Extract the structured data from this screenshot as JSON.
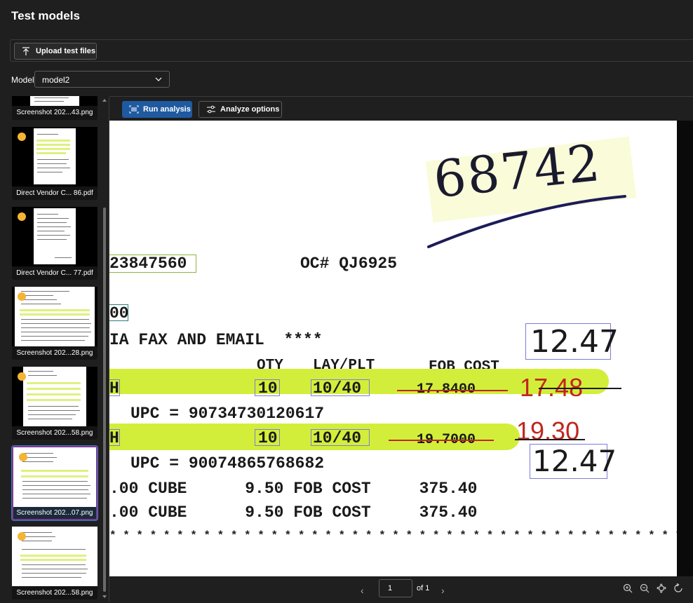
{
  "page": {
    "title": "Test models"
  },
  "toolbar": {
    "upload_label": "Upload test files"
  },
  "model": {
    "label": "Model",
    "selected": "model2"
  },
  "files": [
    {
      "name": "Screenshot 202...43.png",
      "status": "",
      "selected": false
    },
    {
      "name": "Direct Vendor C... 86.pdf",
      "status": "pending",
      "selected": false
    },
    {
      "name": "Direct Vendor C... 77.pdf",
      "status": "pending",
      "selected": false
    },
    {
      "name": "Screenshot 202...28.png",
      "status": "pending",
      "selected": false
    },
    {
      "name": "Screenshot 202...58.png",
      "status": "pending",
      "selected": false
    },
    {
      "name": "Screenshot 202...07.png",
      "status": "pending",
      "selected": true
    },
    {
      "name": "Screenshot 202...58.png",
      "status": "pending",
      "selected": false
    }
  ],
  "viewer": {
    "run_label": "Run analysis",
    "options_label": "Analyze options",
    "document": {
      "handwritten_number": "68742",
      "ref_number": "23847560",
      "oc_label": "OC# QJ6925",
      "teal_value": "00",
      "fax_line": "IA FAX AND EMAIL  ****",
      "header_qty": "QTY",
      "header_lay": "LAY/PLT",
      "header_fob": "FOB COST",
      "row1_h": "H",
      "row1_qty": "10",
      "row1_lay": "10/40",
      "row1_cost": "17.8400",
      "row1_hand": "17.48",
      "upc1": "UPC = 90734730120617",
      "row2_h": "H",
      "row2_qty": "10",
      "row2_lay": "10/40",
      "row2_cost": "19.7000",
      "row2_hand": "19.30",
      "hand_box1": "12.47",
      "hand_box2": "12.47",
      "upc2": "UPC = 90074865768682",
      "cube1": ".00 CUBE      9.50 FOB COST     375.40",
      "cube2": ".00 CUBE      9.50 FOB COST     375.40",
      "stars": "* * * * * * * * * * * * * * * * * * * * * * * * * * * * * * * * * * * * * * * * * * *"
    },
    "pager": {
      "page": "1",
      "of_label": "of 1"
    }
  },
  "colors": {
    "accent": "#1f5aa0",
    "highlight": "#d3ee3a",
    "status_dot": "#f5b434",
    "selection": "#7a3a8f"
  }
}
